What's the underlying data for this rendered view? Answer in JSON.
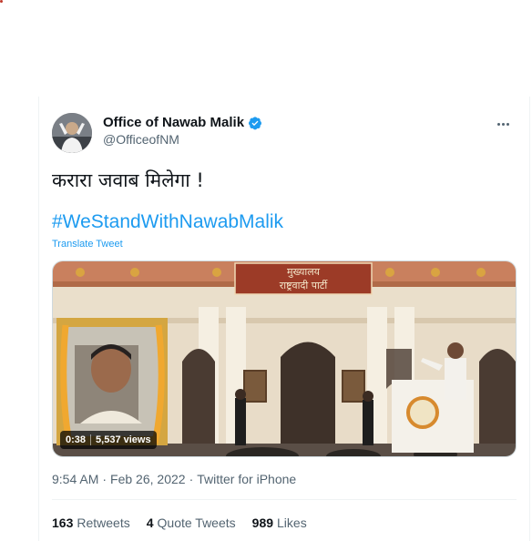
{
  "tweet": {
    "display_name": "Office of Nawab Malik",
    "handle": "@OfficeofNM",
    "text": "करारा जवाब मिलेगा !",
    "hashtag": "#WeStandWithNawabMalik",
    "translate_label": "Translate Tweet",
    "time": "9:54 AM",
    "date": "Feb 26, 2022",
    "source": "Twitter for iPhone",
    "media": {
      "duration": "0:38",
      "views": "5,537 views",
      "sign_line1": "मुख्यालय",
      "sign_line2": "राष्ट्रवादी पार्टी"
    },
    "stats": {
      "retweets_count": "163",
      "retweets_label": "Retweets",
      "quotes_count": "4",
      "quotes_label": "Quote Tweets",
      "likes_count": "989",
      "likes_label": "Likes"
    }
  },
  "colors": {
    "link": "#1d9bf0",
    "secondary_text": "#536471",
    "verified": "#1d9bf0"
  }
}
